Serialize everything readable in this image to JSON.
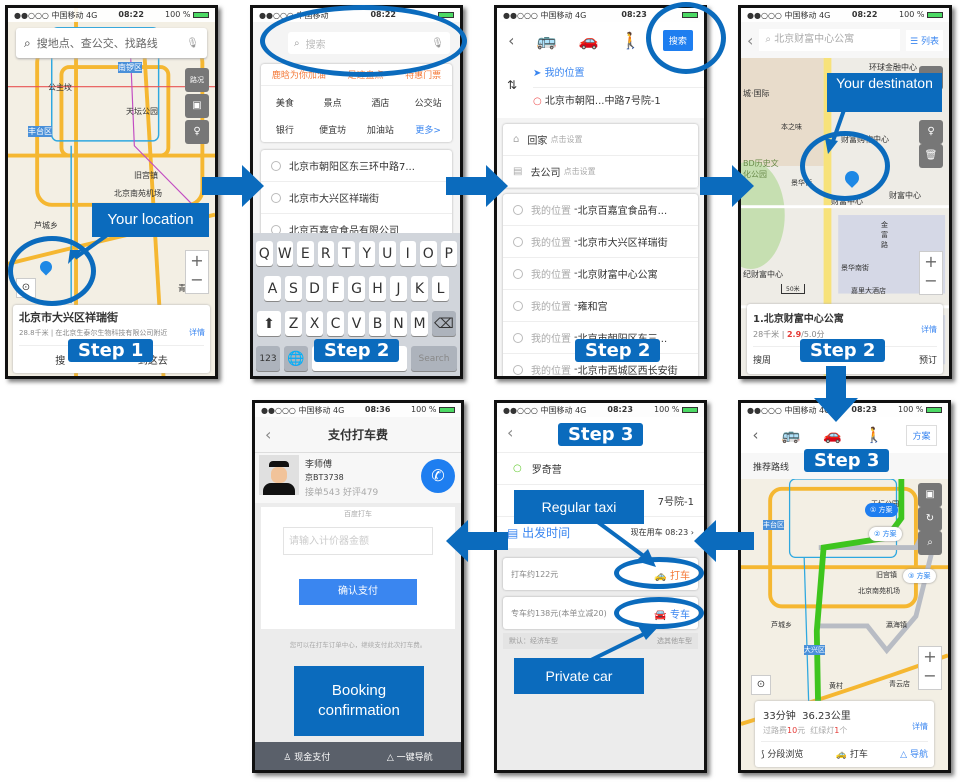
{
  "status": {
    "signal": "●●○○○",
    "carrier": "中国移动",
    "network": "4G",
    "battery": "100 %"
  },
  "phone1": {
    "time": "08:22",
    "search_placeholder": "搜地点、查公交、找路线",
    "map_labels": [
      "公主坟",
      "南锣区",
      "丰台区",
      "天坛公园",
      "旧宫镇",
      "北京南苑机场",
      "芦城乡",
      "大兴",
      "青云店"
    ],
    "traffic_btn": "路况",
    "location_title": "北京市大兴区祥瑞街",
    "distance": "28.8千米",
    "nearby": "在北京生泰尔生物科技有限公司附近",
    "details": "详情",
    "action_left": "搜",
    "action_right": "到这去",
    "callout": "Your location",
    "step": "Step 1"
  },
  "phone2": {
    "time": "08:22",
    "search_placeholder": "搜索",
    "promos": [
      "鹿晗为你加油",
      "足迹盘点",
      "特惠门票"
    ],
    "categories": [
      "美食",
      "景点",
      "酒店",
      "公交站",
      "银行",
      "便宜坊",
      "加油站",
      "更多>"
    ],
    "history": [
      "北京市朝阳区东三环中路7...",
      "北京市大兴区祥瑞街",
      "北京百嘉宜食品有限公司"
    ],
    "keys_row1": [
      "Q",
      "W",
      "E",
      "R",
      "T",
      "Y",
      "U",
      "I",
      "O",
      "P"
    ],
    "keys_row2": [
      "A",
      "S",
      "D",
      "F",
      "G",
      "H",
      "J",
      "K",
      "L"
    ],
    "keys_row3": [
      "Z",
      "X",
      "C",
      "V",
      "B",
      "N",
      "M"
    ],
    "key_123": "123",
    "key_search": "Search",
    "step": "Step 2"
  },
  "phone3": {
    "time": "08:23",
    "search_btn": "搜索",
    "origin": "我的位置",
    "destination": "北京市朝阳...中路7号院-1",
    "home": "回家",
    "home_hint": "点击设置",
    "work": "去公司",
    "work_hint": "点击设置",
    "history_prefix": "我的位置",
    "history": [
      "北京百嘉宜食品有...",
      "北京市大兴区祥瑞街",
      "北京财富中心公寓",
      "雍和宫",
      "北京市朝阳区东三...",
      "北京市西城区西长安街"
    ],
    "step": "Step 2"
  },
  "phone4": {
    "time": "08:22",
    "search_value": "北京财富中心公寓",
    "list_btn": "列表",
    "map_labels": [
      "环球金融中心",
      "城·国际",
      "本之味",
      "财富购物中心",
      "BD历史文化公园",
      "景华街",
      "财富中心",
      "财富中心",
      "金富路",
      "景华南街",
      "纪财富中心",
      "嘉里大酒店",
      "富"
    ],
    "scale": "50米",
    "result_title": "1.北京财富中心公寓",
    "distance": "28千米",
    "rating": "2.9",
    "rating_max": "/5.0分",
    "details": "详情",
    "action_left": "搜周",
    "action_right": "预订",
    "callout": "Your destinaton",
    "step": "Step 2"
  },
  "phone5": {
    "time": "08:36",
    "title": "支付打车费",
    "driver_name": "李师傅",
    "plate": "京BT3738",
    "stats": "接单543 好评479",
    "brand": "百度打车",
    "amount_placeholder": "请输入计价器金额",
    "confirm": "确认支付",
    "note": "您可以在打车订单中心，继续支付此次打车费。",
    "cash": "现金支付",
    "navigate": "一键导航",
    "callout": "Booking confirmation"
  },
  "phone6": {
    "time": "08:23",
    "origin": "罗奇营",
    "destination": "7号院-1",
    "depart_label": "出发时间",
    "depart_value": "现在用车 08:23",
    "taxi_price": "打车约122元",
    "taxi_btn": "打车",
    "private_price": "专车约138元(本单立减20)",
    "private_btn": "专车",
    "default_type": "默认：经济车型",
    "other_type": "选其他车型",
    "callout_taxi": "Regular taxi",
    "callout_private": "Private car",
    "step": "Step 3"
  },
  "phone7": {
    "time": "08:23",
    "plan_btn": "方案",
    "recommended": "推荐路线",
    "routes": [
      "方案",
      "方案",
      "方案"
    ],
    "map_labels": [
      "天坛公园",
      "丰台区",
      "旧宫镇",
      "北京南苑机场",
      "芦城乡",
      "瀛海镇",
      "大兴区",
      "黄村",
      "青云店"
    ],
    "duration": "33分钟",
    "distance": "36.23公里",
    "toll_label": "过路费",
    "toll": "10",
    "toll_unit": "元",
    "lights_label": "红绿灯",
    "lights": "1",
    "lights_unit": "个",
    "details": "详情",
    "segments": "分段浏览",
    "taxi": "打车",
    "nav": "导航",
    "step": "Step 3"
  },
  "colors": {
    "accent": "#0b6bbd",
    "app_blue": "#3a86f0",
    "route_green": "#3ec51e",
    "taxi_orange": "#f47b3b",
    "price_red": "#e53935"
  }
}
